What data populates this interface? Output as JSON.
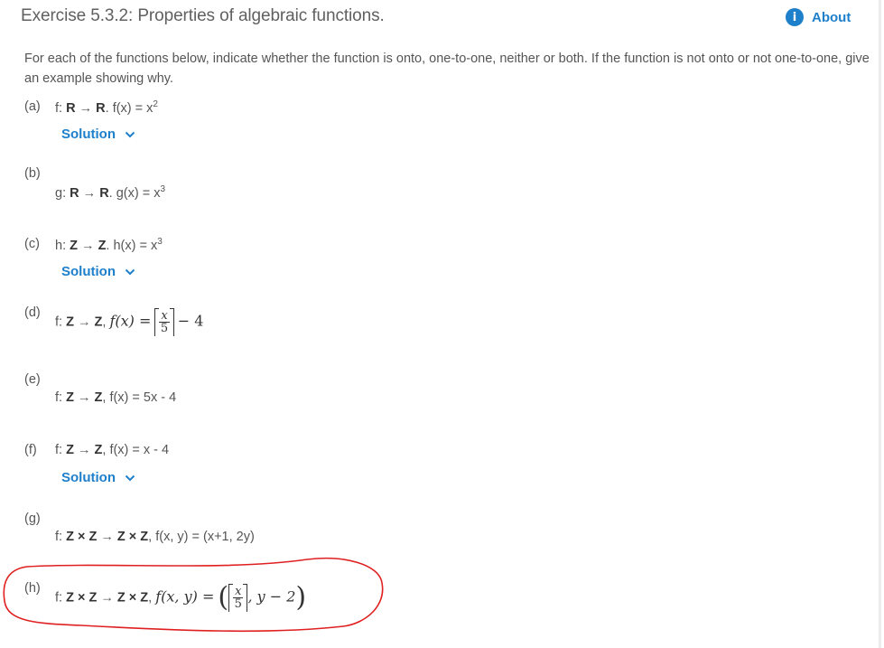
{
  "header": {
    "title": "Exercise 5.3.2: Properties of algebraic functions.",
    "about_label": "About",
    "about_icon": "info-icon",
    "accent_color": "#1e7fcb"
  },
  "intro": "For each of the functions below, indicate whether the function is onto, one-to-one, neither or both. If the function is not onto or not one-to-one, give an example showing why.",
  "items": [
    {
      "label": "(a)",
      "name": "f",
      "domain": "R",
      "codomain": "R",
      "formula": "f(x) = x",
      "exp": "2",
      "has_solution": true
    },
    {
      "label": "(b)",
      "name": "g",
      "domain": "R",
      "codomain": "R",
      "formula": "g(x) = x",
      "exp": "3",
      "has_solution": false
    },
    {
      "label": "(c)",
      "name": "h",
      "domain": "Z",
      "codomain": "Z",
      "formula": "h(x) = x",
      "exp": "3",
      "has_solution": true
    },
    {
      "label": "(d)",
      "name": "f",
      "domain": "Z",
      "codomain": "Z",
      "lhs": "f(x) =",
      "frac_num": "x",
      "frac_den": "5",
      "tail": "− 4",
      "has_solution": false
    },
    {
      "label": "(e)",
      "name": "f",
      "domain": "Z",
      "codomain": "Z",
      "formula": "f(x) = 5x - 4",
      "has_solution": false
    },
    {
      "label": "(f)",
      "name": "f",
      "domain": "Z",
      "codomain": "Z",
      "formula": "f(x) = x - 4",
      "has_solution": true
    },
    {
      "label": "(g)",
      "name": "f",
      "domain": "Z × Z",
      "codomain": "Z × Z",
      "formula": "f(x, y) = (x+1, 2y)",
      "has_solution": false
    },
    {
      "label": "(h)",
      "name": "f",
      "domain": "Z × Z",
      "codomain": "Z × Z",
      "lhs": "f(x, y) =",
      "frac_num": "x",
      "frac_den": "5",
      "tail": ", y − 2",
      "has_solution": false,
      "annotated": true
    }
  ],
  "solution_label": "Solution",
  "annotation_color": "#e02020"
}
